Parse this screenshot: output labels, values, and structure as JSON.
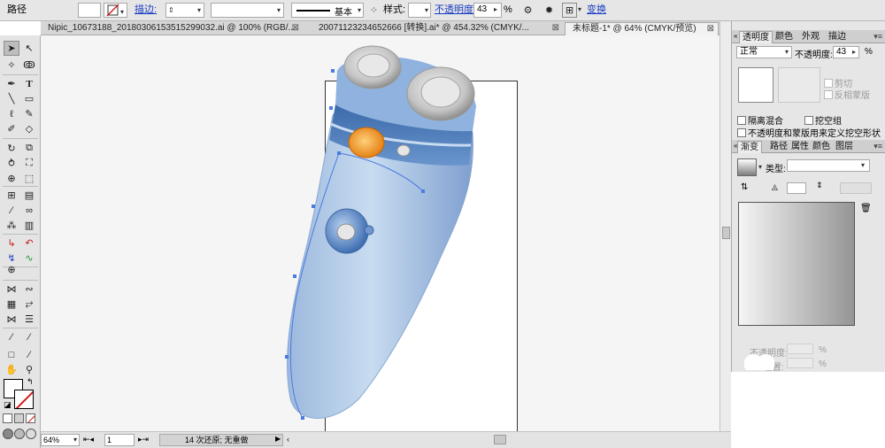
{
  "control_bar": {
    "object_type": "路径",
    "stroke_label": "描边:",
    "stroke_profile": "基本",
    "style_label": "样式:",
    "opacity_label": "不透明度:",
    "opacity_value": "43",
    "opacity_unit": "%",
    "transform_label": "变换"
  },
  "tabs": [
    {
      "label": "Nipic_10673188_20180306153515299032.ai @ 100% (RGB/...",
      "active": false
    },
    {
      "label": "20071123234652666 [转换].ai* @ 454.32% (CMYK/...",
      "active": false
    },
    {
      "label": "未标题-1* @ 64% (CMYK/预览)",
      "active": true
    }
  ],
  "transparency_panel": {
    "tabs": [
      "透明度",
      "颜色",
      "外观",
      "描边"
    ],
    "blend_mode": "正常",
    "opacity_label": "不透明度:",
    "opacity_value": "43",
    "opacity_unit": "%",
    "clip_label": "剪切",
    "invert_mask_label": "反相蒙版",
    "isolate_blending_label": "隔离混合",
    "knockout_group_label": "挖空组",
    "opacity_mask_label": "不透明度和蒙版用来定义挖空形状"
  },
  "gradient_panel": {
    "tabs": [
      "渐变",
      "路径",
      "属性",
      "颜色",
      "图层"
    ],
    "type_label": "类型:",
    "opacity_label": "不透明度:",
    "location_label": "位置:",
    "unit": "%"
  },
  "status_bar": {
    "zoom": "64%",
    "page": "1",
    "history": "14 次还原; 无重做"
  }
}
